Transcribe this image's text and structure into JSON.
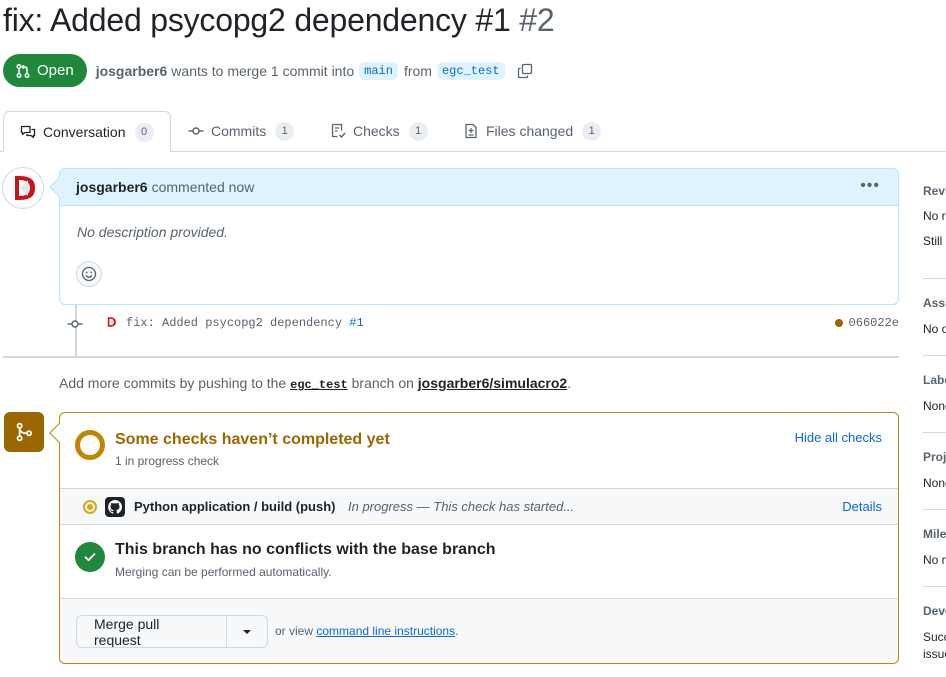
{
  "pr": {
    "title": "fix: Added psycopg2 dependency #1",
    "number": "#2",
    "state": "Open",
    "author": "josgarber6",
    "merge_text_1": "wants to merge 1 commit into",
    "base_branch": "main",
    "from_text": "from",
    "head_branch": "egc_test"
  },
  "tabs": [
    {
      "label": "Conversation",
      "count": "0"
    },
    {
      "label": "Commits",
      "count": "1"
    },
    {
      "label": "Checks",
      "count": "1"
    },
    {
      "label": "Files changed",
      "count": "1"
    }
  ],
  "comment": {
    "author": "josgarber6",
    "action": "commented now",
    "body": "No description provided."
  },
  "commit": {
    "message": "fix: Added psycopg2 dependency",
    "ref": "#1",
    "sha": "066022e"
  },
  "push_hint": {
    "prefix": "Add more commits by pushing to the",
    "branch": "egc_test",
    "middle": "branch on",
    "repo": "josgarber6/simulacro2",
    "suffix": "."
  },
  "checks": {
    "title": "Some checks haven’t completed yet",
    "subtitle": "1 in progress check",
    "hide_label": "Hide all checks",
    "items": [
      {
        "name": "Python application / build (push)",
        "status": "In progress — This check has started...",
        "details": "Details"
      }
    ]
  },
  "conflicts": {
    "title": "This branch has no conflicts with the base branch",
    "subtitle": "Merging can be performed automatically."
  },
  "merge": {
    "button": "Merge pull request",
    "or_view": "or view",
    "cli_link": "command line instructions",
    "period": "."
  },
  "sidebar": {
    "reviewers": {
      "head": "Reviewers",
      "lines": [
        "No reviews",
        "Still in progress?"
      ]
    },
    "assignees": {
      "head": "Assignees",
      "text": "No one assigned"
    },
    "labels": {
      "head": "Labels",
      "text": "None yet"
    },
    "projects": {
      "head": "Projects",
      "text": "None yet"
    },
    "milestone": {
      "head": "Milestone",
      "text": "No milestone"
    },
    "development": {
      "head": "Development",
      "lines": [
        "Successfully merging this pull request may close these",
        "issues."
      ]
    }
  },
  "colors": {
    "open_green": "#1f883d",
    "pending_amber": "#9a6700",
    "link_blue": "#0969da",
    "header_blue": "#ddf4ff"
  }
}
